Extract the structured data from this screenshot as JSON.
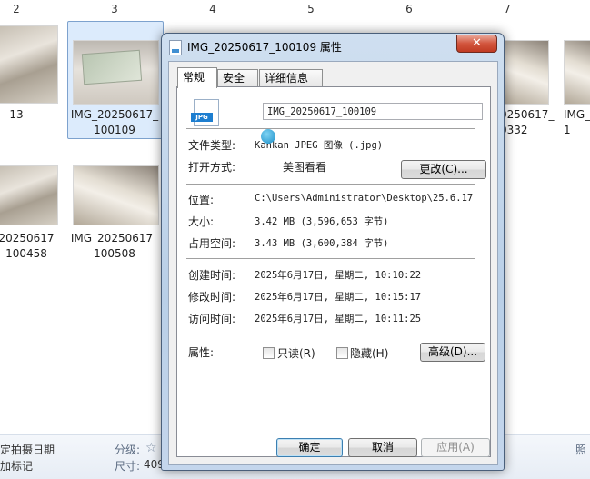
{
  "explorer": {
    "column_numbers": [
      "2",
      "3",
      "4",
      "5",
      "6",
      "7"
    ],
    "files": {
      "f13": "13",
      "f100109": "IMG_20250617_\n100109",
      "f100332": "0250617_\n0332",
      "f_right": "IMG_\n1",
      "f100458": "_20250617_\n100458",
      "f100508": "IMG_20250617_\n100508"
    },
    "status": {
      "left1": "定拍摄日期",
      "left2": "加标记",
      "rating_label": "分级:",
      "rating_star": "☆",
      "size_label": "尺寸:",
      "size_value": "409",
      "right": "照"
    }
  },
  "dialog": {
    "title": "IMG_20250617_100109 属性",
    "close_symbol": "✕",
    "tabs": [
      "常规",
      "安全",
      "详细信息"
    ],
    "file_icon_text": "JPG",
    "filename": "IMG_20250617_100109",
    "rows": {
      "type_label": "文件类型:",
      "type_value": "Kankan JPEG 图像 (.jpg)",
      "open_label": "打开方式:",
      "open_value": "美图看看",
      "change_button": "更改(C)...",
      "location_label": "位置:",
      "location_value": "C:\\Users\\Administrator\\Desktop\\25.6.17",
      "size_label": "大小:",
      "size_value": "3.42 MB (3,596,653 字节)",
      "disk_label": "占用空间:",
      "disk_value": "3.43 MB (3,600,384 字节)",
      "created_label": "创建时间:",
      "created_value": "2025年6月17日, 星期二, 10:10:22",
      "modified_label": "修改时间:",
      "modified_value": "2025年6月17日, 星期二, 10:15:17",
      "accessed_label": "访问时间:",
      "accessed_value": "2025年6月17日, 星期二, 10:11:25",
      "attr_label": "属性:",
      "readonly_label": "只读(R)",
      "hidden_label": "隐藏(H)",
      "advanced_button": "高级(D)..."
    },
    "buttons": {
      "ok": "确定",
      "cancel": "取消",
      "apply": "应用(A)"
    }
  }
}
